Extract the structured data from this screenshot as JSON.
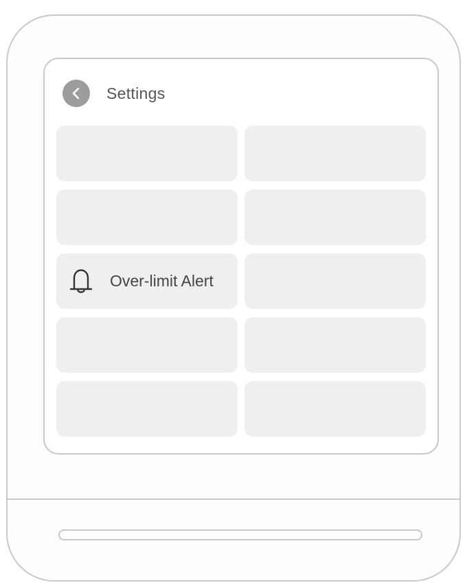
{
  "header": {
    "back_icon": "chevron-left-icon",
    "title": "Settings"
  },
  "tiles": [
    {
      "label": "",
      "icon": ""
    },
    {
      "label": "",
      "icon": ""
    },
    {
      "label": "",
      "icon": ""
    },
    {
      "label": "",
      "icon": ""
    },
    {
      "label": "Over-limit Alert",
      "icon": "bell-icon"
    },
    {
      "label": "",
      "icon": ""
    },
    {
      "label": "",
      "icon": ""
    },
    {
      "label": "",
      "icon": ""
    },
    {
      "label": "",
      "icon": ""
    },
    {
      "label": "",
      "icon": ""
    }
  ],
  "colors": {
    "outline": "#c8c8c8",
    "tile_background": "#efefef",
    "back_button": "#9c9c9c",
    "text": "#555555"
  }
}
